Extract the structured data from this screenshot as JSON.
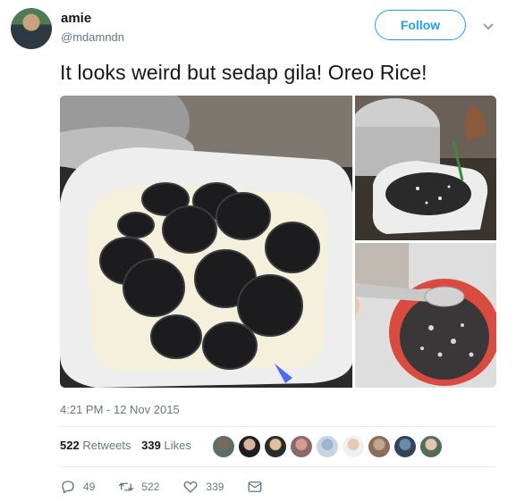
{
  "author": {
    "name": "amie",
    "handle": "@mdamndn"
  },
  "follow_label": "Follow",
  "tweet": {
    "text": "It looks weird but sedap gila! Oreo Rice!",
    "timestamp": "4:21 PM - 12 Nov 2015"
  },
  "stats": {
    "retweets_count": "522",
    "retweets_label": "Retweets",
    "likes_count": "339",
    "likes_label": "Likes"
  },
  "actions": {
    "replies": "49",
    "retweets": "522",
    "likes": "339"
  },
  "icons": {
    "reply": "reply-icon",
    "retweet": "retweet-icon",
    "like": "heart-icon",
    "message": "direct-message-icon",
    "menu": "chevron-down-icon"
  },
  "colors": {
    "accent": "#1da1f2",
    "muted_text": "#657786",
    "divider": "#e6ecf0"
  }
}
